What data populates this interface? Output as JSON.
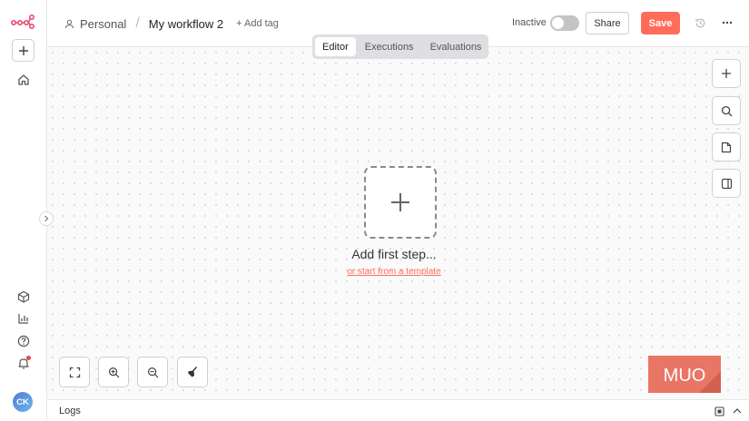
{
  "sidebar": {
    "collapse_hint": "expand-sidebar",
    "avatar_initials": "CK"
  },
  "header": {
    "project": "Personal",
    "workflow_title": "My workflow 2",
    "add_tag": "+ Add tag",
    "status_label": "Inactive",
    "share_label": "Share",
    "save_label": "Save"
  },
  "tabs": [
    {
      "label": "Editor",
      "active": true
    },
    {
      "label": "Executions",
      "active": false
    },
    {
      "label": "Evaluations",
      "active": false
    }
  ],
  "canvas": {
    "add_first_step": "Add first step...",
    "template_link": "or start from a template"
  },
  "watermark": {
    "text": "MUO"
  },
  "logs": {
    "label": "Logs"
  },
  "colors": {
    "accent": "#ff6d5a",
    "logo": "#ea4b71",
    "notification": "#e5484d"
  }
}
